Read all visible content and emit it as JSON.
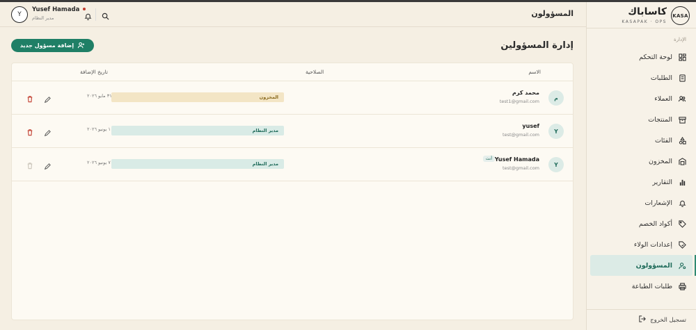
{
  "brand": {
    "logo_text": "KASA",
    "name_ar": "كاساباك",
    "name_en": "KASAPAK · OPS"
  },
  "sidebar": {
    "section_label": "الإدارة",
    "items": [
      {
        "label": "لوحة التحكم",
        "icon": "dashboard-icon"
      },
      {
        "label": "الطلبات",
        "icon": "orders-icon"
      },
      {
        "label": "العملاء",
        "icon": "customers-icon"
      },
      {
        "label": "المنتجات",
        "icon": "products-icon"
      },
      {
        "label": "الفئات",
        "icon": "categories-icon"
      },
      {
        "label": "المخزون",
        "icon": "warehouse-icon"
      },
      {
        "label": "التقارير",
        "icon": "reports-icon"
      },
      {
        "label": "الإشعارات",
        "icon": "bell-icon"
      },
      {
        "label": "أكواد الخصم",
        "icon": "tag-icon"
      },
      {
        "label": "إعدادات الولاء",
        "icon": "loyalty-tag-icon"
      },
      {
        "label": "المسؤولون",
        "icon": "admins-icon",
        "active": true
      },
      {
        "label": "طلبات الطباعة",
        "icon": "printer-icon"
      }
    ],
    "logout_label": "تسجيل الخروج"
  },
  "header": {
    "title": "المسؤولون",
    "user": {
      "initial": "Y",
      "name": "Yusef Hamada",
      "role": "مدير النظام"
    }
  },
  "main": {
    "page_title": "إدارة المسؤولين",
    "add_button_label": "إضافة مسؤول جديد",
    "table": {
      "columns": {
        "name": "الاسم",
        "role": "الصلاحية",
        "date": "تاريخ الإضافة"
      },
      "rows": [
        {
          "initial": "م",
          "name": "محمد كرم",
          "email": "test1@gmail.com",
          "role": "المخزون",
          "role_type": "store",
          "date": "٣١ مايو ٢٠٢٦",
          "you": ""
        },
        {
          "initial": "Y",
          "name": "yusef",
          "email": "test@gmail.com",
          "role": "مدير النظام",
          "role_type": "sys",
          "date": "١ يونيو ٢٠٢٦",
          "you": ""
        },
        {
          "initial": "Y",
          "name": "Yusef Hamada",
          "email": "test@gmail.com",
          "role": "مدير النظام",
          "role_type": "sys",
          "date": "٧ يونيو ٢٠٢٦",
          "you": "أنت"
        }
      ]
    }
  },
  "colors": {
    "accent": "#1f7f66",
    "active_bg": "#dcebe6",
    "store_tag": "#f3e5c5",
    "danger": "#c0392b"
  }
}
